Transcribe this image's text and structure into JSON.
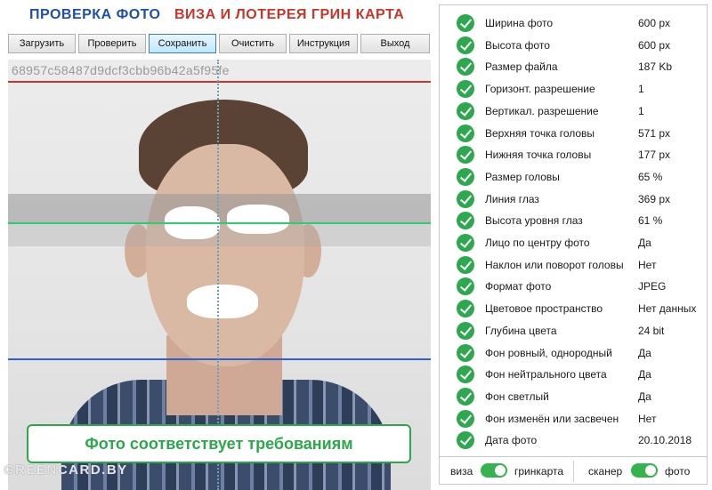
{
  "header": {
    "title_left": "ПРОВЕРКА ФОТО",
    "title_right": "ВИЗА И ЛОТЕРЕЯ ГРИН КАРТА"
  },
  "toolbar": {
    "load": "Загрузить",
    "check": "Проверить",
    "save": "Сохранить",
    "clear": "Очистить",
    "instruction": "Инструкция",
    "exit": "Выход"
  },
  "photo": {
    "hash": "68957c58487d9dcf3cbb96b42a5f95fe",
    "result": "Фото соответствует требованиям",
    "watermark": "GREENCARD.BY"
  },
  "checks": [
    {
      "label": "Ширина фото",
      "value": "600 px"
    },
    {
      "label": "Высота фото",
      "value": "600 px"
    },
    {
      "label": "Размер файла",
      "value": "187 Kb"
    },
    {
      "label": "Горизонт. разрешение",
      "value": "1"
    },
    {
      "label": "Вертикал. разрешение",
      "value": "1"
    },
    {
      "label": "Верхняя точка головы",
      "value": "571 px"
    },
    {
      "label": "Нижняя точка головы",
      "value": "177 px"
    },
    {
      "label": "Размер головы",
      "value": "65 %"
    },
    {
      "label": "Линия глаз",
      "value": "369 px"
    },
    {
      "label": "Высота уровня глаз",
      "value": "61 %"
    },
    {
      "label": "Лицо по центру фото",
      "value": "Да"
    },
    {
      "label": "Наклон или поворот головы",
      "value": "Нет"
    },
    {
      "label": "Формат фото",
      "value": "JPEG"
    },
    {
      "label": "Цветовое пространство",
      "value": "Нет данных"
    },
    {
      "label": "Глубина цвета",
      "value": "24 bit"
    },
    {
      "label": "Фон ровный, однородный",
      "value": "Да"
    },
    {
      "label": "Фон нейтрального цвета",
      "value": "Да"
    },
    {
      "label": "Фон светлый",
      "value": "Да"
    },
    {
      "label": "Фон изменён или засвечен",
      "value": "Нет"
    },
    {
      "label": "Дата фото",
      "value": "20.10.2018"
    }
  ],
  "switches": {
    "mode_left": "виза",
    "mode_right": "гринкарта",
    "source_left": "сканер",
    "source_right": "фото"
  },
  "colors": {
    "title_blue": "#1f4fa8",
    "title_red": "#c8352a",
    "check_green": "#2ea84f",
    "line_red": "#c0392b",
    "line_green": "#2ecc71",
    "line_blue": "#2f5fd0"
  }
}
